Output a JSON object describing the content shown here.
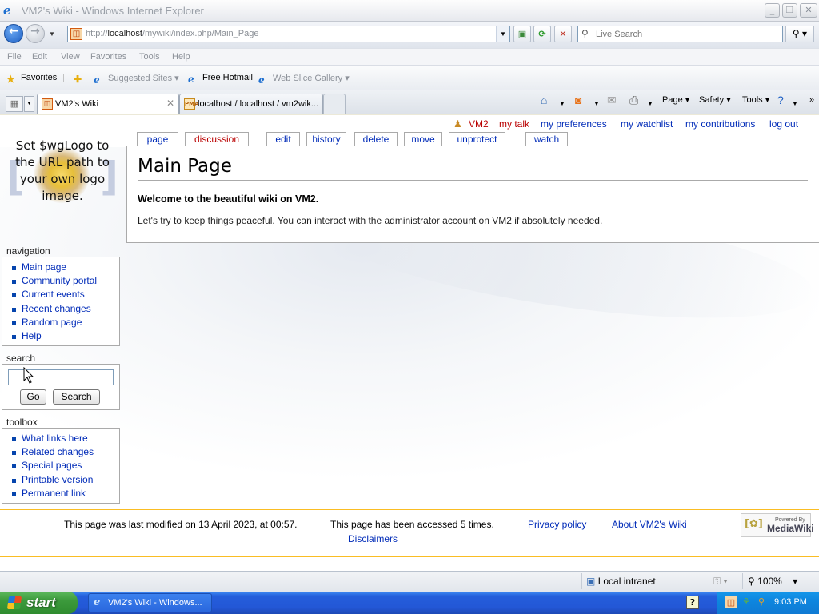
{
  "window": {
    "title": "VM2's Wiki - Windows Internet Explorer"
  },
  "address": {
    "url_prefix": "http://",
    "url_host": "localhost",
    "url_path": "/mywiki/index.php/Main_Page"
  },
  "search": {
    "placeholder": "Live Search"
  },
  "menu": [
    "File",
    "Edit",
    "View",
    "Favorites",
    "Tools",
    "Help"
  ],
  "favorites": {
    "label": "Favorites",
    "suggested": "Suggested Sites",
    "hotmail": "Free Hotmail",
    "webslice": "Web Slice Gallery"
  },
  "tabs": [
    {
      "label": "VM2's Wiki"
    },
    {
      "label": "localhost / localhost / vm2wik...",
      "favicon_text": "PMA"
    }
  ],
  "commandbar": {
    "page": "Page",
    "safety": "Safety",
    "tools": "Tools"
  },
  "wiki": {
    "logo_text": "Set $wgLogo to the URL path to your own logo image.",
    "personal": {
      "user": "VM2",
      "talk": "my talk",
      "preferences": "my preferences",
      "watchlist": "my watchlist",
      "contributions": "my contributions",
      "logout": "log out"
    },
    "content_tabs": {
      "page": "page",
      "discussion": "discussion",
      "edit": "edit",
      "history": "history",
      "delete": "delete",
      "move": "move",
      "unprotect": "unprotect",
      "watch": "watch"
    },
    "heading": "Main Page",
    "welcome": "Welcome to the beautiful wiki on VM2.",
    "body": "Let's try to keep things peaceful. You can interact with the administrator account on VM2 if absolutely needed.",
    "navigation": {
      "title": "navigation",
      "items": [
        "Main page",
        "Community portal",
        "Current events",
        "Recent changes",
        "Random page",
        "Help"
      ]
    },
    "search_portlet": {
      "title": "search",
      "go": "Go",
      "search": "Search"
    },
    "toolbox": {
      "title": "toolbox",
      "items": [
        "What links here",
        "Related changes",
        "Special pages",
        "Printable version",
        "Permanent link"
      ]
    },
    "footer": {
      "lastmod": "This page was last modified on 13 April 2023, at 00:57.",
      "accessed": "This page has been accessed 5 times.",
      "privacy": "Privacy policy",
      "about": "About VM2's Wiki",
      "disclaimers": "Disclaimers",
      "powered_top": "Powered By",
      "powered_name": "MediaWiki"
    }
  },
  "statusbar": {
    "zone": "Local intranet",
    "zoom": "100%"
  },
  "taskbar": {
    "start": "start",
    "window": "VM2's Wiki - Windows...",
    "clock": "9:03 PM"
  }
}
